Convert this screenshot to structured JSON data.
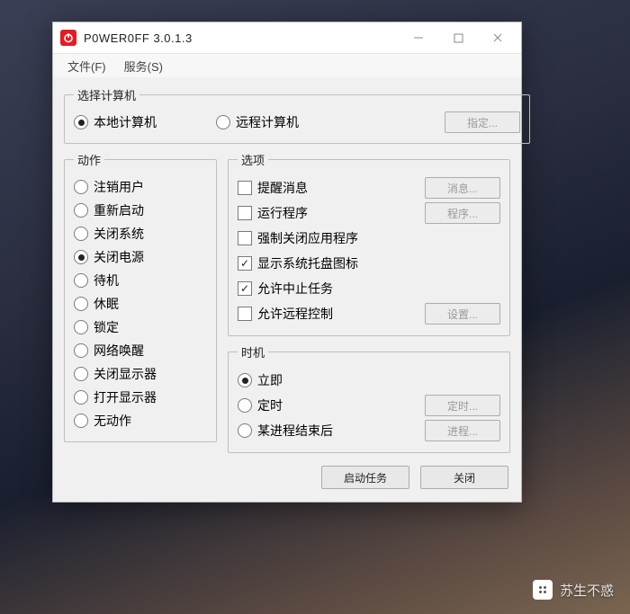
{
  "title": "P0WER0FF 3.0.1.3",
  "menu": {
    "file": "文件(F)",
    "service": "服务(S)"
  },
  "groups": {
    "computer": {
      "legend": "选择计算机",
      "local": "本地计算机",
      "remote": "远程计算机",
      "specify_btn": "指定..."
    },
    "action": {
      "legend": "动作",
      "items": [
        "注销用户",
        "重新启动",
        "关闭系统",
        "关闭电源",
        "待机",
        "休眠",
        "锁定",
        "网络唤醒",
        "关闭显示器",
        "打开显示器",
        "无动作"
      ],
      "selected_index": 3
    },
    "options": {
      "legend": "选项",
      "items": [
        {
          "label": "提醒消息",
          "checked": false,
          "btn": "消息..."
        },
        {
          "label": "运行程序",
          "checked": false,
          "btn": "程序..."
        },
        {
          "label": "强制关闭应用程序",
          "checked": false
        },
        {
          "label": "显示系统托盘图标",
          "checked": true
        },
        {
          "label": "允许中止任务",
          "checked": true
        },
        {
          "label": "允许远程控制",
          "checked": false,
          "btn": "设置..."
        }
      ]
    },
    "timing": {
      "legend": "时机",
      "items": [
        {
          "label": "立即",
          "selected": true
        },
        {
          "label": "定时",
          "selected": false,
          "btn": "定时..."
        },
        {
          "label": "某进程结束后",
          "selected": false,
          "btn": "进程..."
        }
      ]
    }
  },
  "buttons": {
    "start": "启动任务",
    "close": "关闭"
  },
  "watermark": "苏生不惑"
}
